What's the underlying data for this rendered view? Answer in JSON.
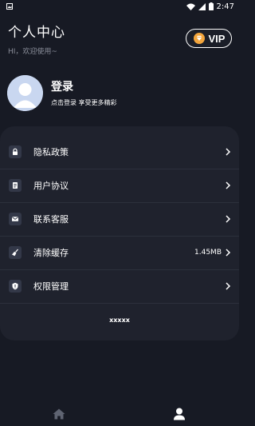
{
  "status_bar": {
    "time": "2:47"
  },
  "header": {
    "title": "个人中心",
    "greeting": "HI，欢迎使用~",
    "vip_label": "VIP"
  },
  "profile": {
    "name": "登录",
    "subtitle": "点击登录 享受更多精彩"
  },
  "menu": {
    "items": [
      {
        "label": "隐私政策",
        "icon": "lock-icon",
        "value": ""
      },
      {
        "label": "用户协议",
        "icon": "document-icon",
        "value": ""
      },
      {
        "label": "联系客服",
        "icon": "mail-icon",
        "value": ""
      },
      {
        "label": "清除缓存",
        "icon": "broom-icon",
        "value": "1.45MB"
      },
      {
        "label": "权限管理",
        "icon": "shield-icon",
        "value": ""
      }
    ],
    "footer": "xxxxx"
  },
  "tabs": [
    {
      "icon": "home-icon",
      "active": false
    },
    {
      "icon": "profile-icon",
      "active": true
    }
  ],
  "colors": {
    "background": "#171a24",
    "card": "#1f222d",
    "icon_bg": "#333848",
    "inactive_tab": "#5f6472",
    "accent_gem": "#f3a53c"
  }
}
